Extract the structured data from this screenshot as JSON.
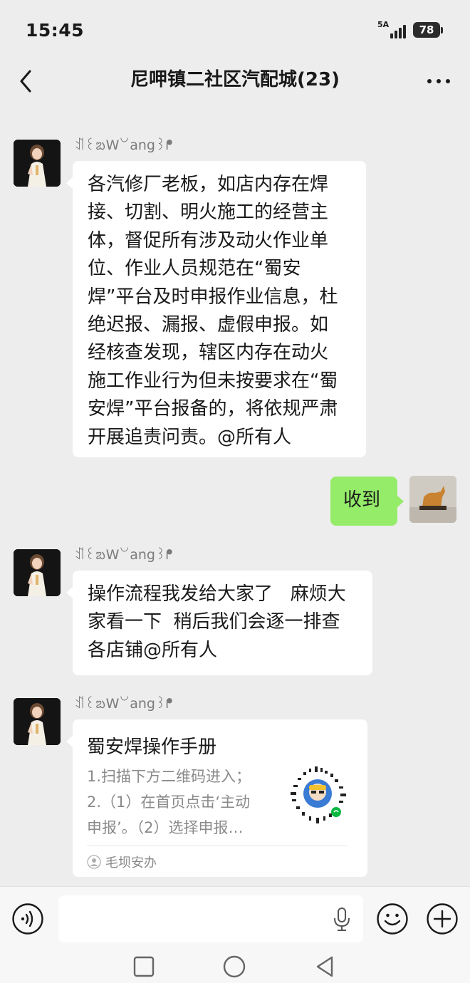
{
  "status_bar": {
    "time": "15:45",
    "network": "5A",
    "battery": "78"
  },
  "header": {
    "title": "尼呷镇二社区汽配城(23)"
  },
  "messages": [
    {
      "sender": "ꀊ꒰ᨰW꒡ang꒱ᖰ",
      "lines": [
        "各汽修厂老板，如店内存在焊",
        "接、切割、明火施工的经营主",
        "体，督促所有涉及动火作业单",
        "位、作业人员规范在“蜀安",
        "焊”平台及时申报作业信息，杜",
        "绝迟报、漏报、虚假申报。如",
        "经核查发现，辖区内存在动火",
        "施工作业行为但未按要求在“蜀",
        "安焊”平台报备的，将依规严肃",
        "开展追责问责。@所有人"
      ]
    },
    {
      "text": "收到"
    },
    {
      "sender": "ꀊ꒰ᨰW꒡ang꒱ᖰ",
      "lines": [
        "操作流程我发给大家了   麻烦大",
        "家看一下  稍后我们会逐一排查",
        "各店铺@所有人"
      ]
    },
    {
      "sender": "ꀊ꒰ᨰW꒡ang꒱ᖰ",
      "card": {
        "title": "蜀安焊操作手册",
        "desc_lines": [
          "1.扫描下方二维码进入；",
          "2.（1）在首页点击‘主动",
          "申报’。（2）选择申报…"
        ],
        "source": "毛坝安办"
      }
    }
  ],
  "icons": {
    "back": "chevron-left-icon",
    "more": "more-dots-icon",
    "voice": "voice-icon",
    "mic": "microphone-icon",
    "emoji": "emoji-icon",
    "plus": "plus-icon",
    "nav_recent": "square-icon",
    "nav_home": "circle-icon",
    "nav_back": "triangle-back-icon"
  },
  "colors": {
    "background": "#ededed",
    "bubble_self": "#95ec69",
    "bubble_other": "#ffffff",
    "secondary_text": "#8a8a8a"
  }
}
